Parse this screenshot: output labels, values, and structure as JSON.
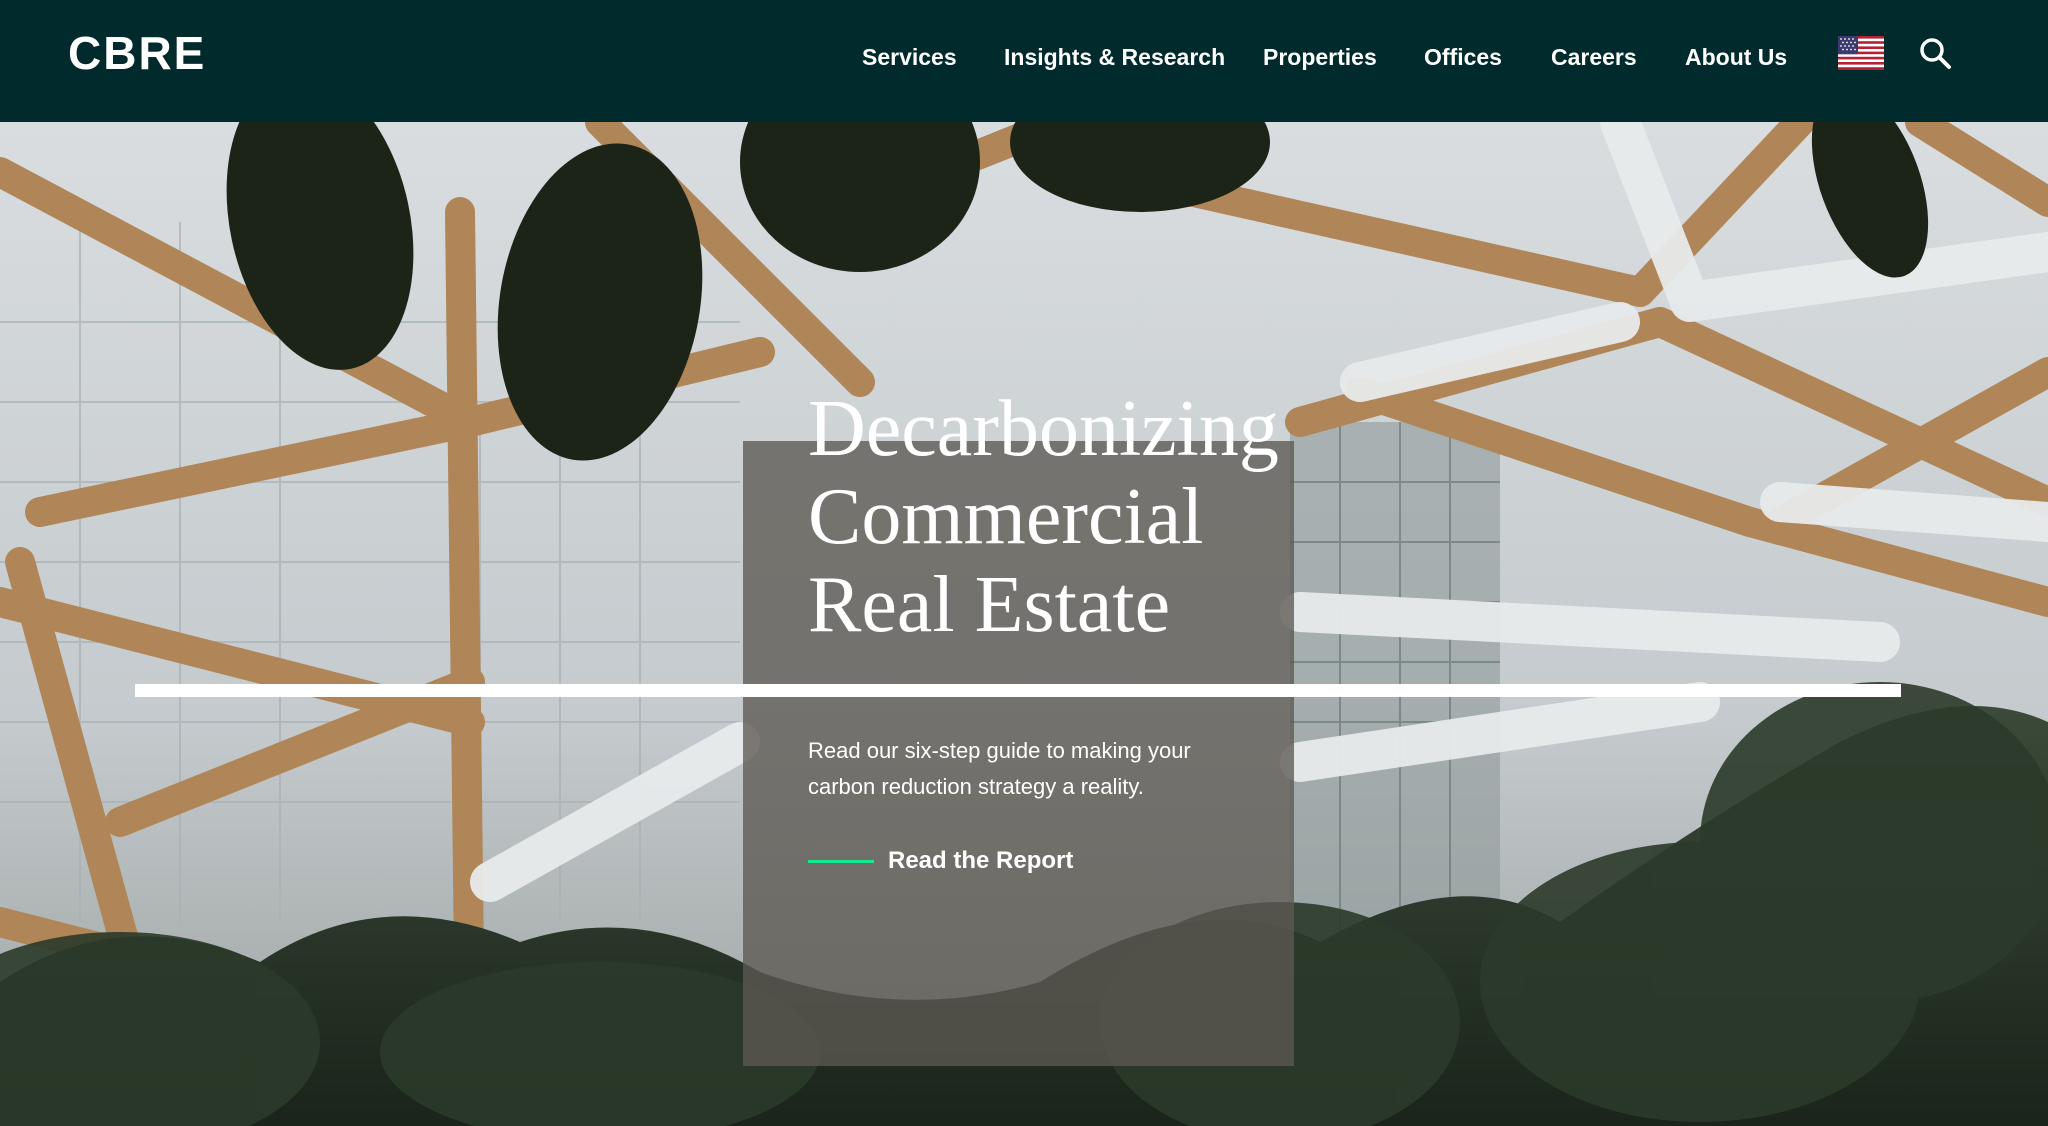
{
  "header": {
    "logo_text": "CBRE",
    "nav": [
      {
        "label": "Services"
      },
      {
        "label": "Insights & Research"
      },
      {
        "label": "Properties"
      },
      {
        "label": "Offices"
      },
      {
        "label": "Careers"
      },
      {
        "label": "About Us"
      }
    ],
    "locale_icon": "us-flag-icon",
    "search_icon": "search-icon"
  },
  "hero": {
    "title_lines": [
      "Decarbonizing",
      "Commercial",
      "Real Estate"
    ],
    "description": "Read our six-step guide to making your carbon reduction strategy a reality.",
    "cta_label": "Read the Report"
  },
  "colors": {
    "header_bg": "#012a2d",
    "accent_green": "#17e88f",
    "card_overlay": "#5c5852"
  }
}
